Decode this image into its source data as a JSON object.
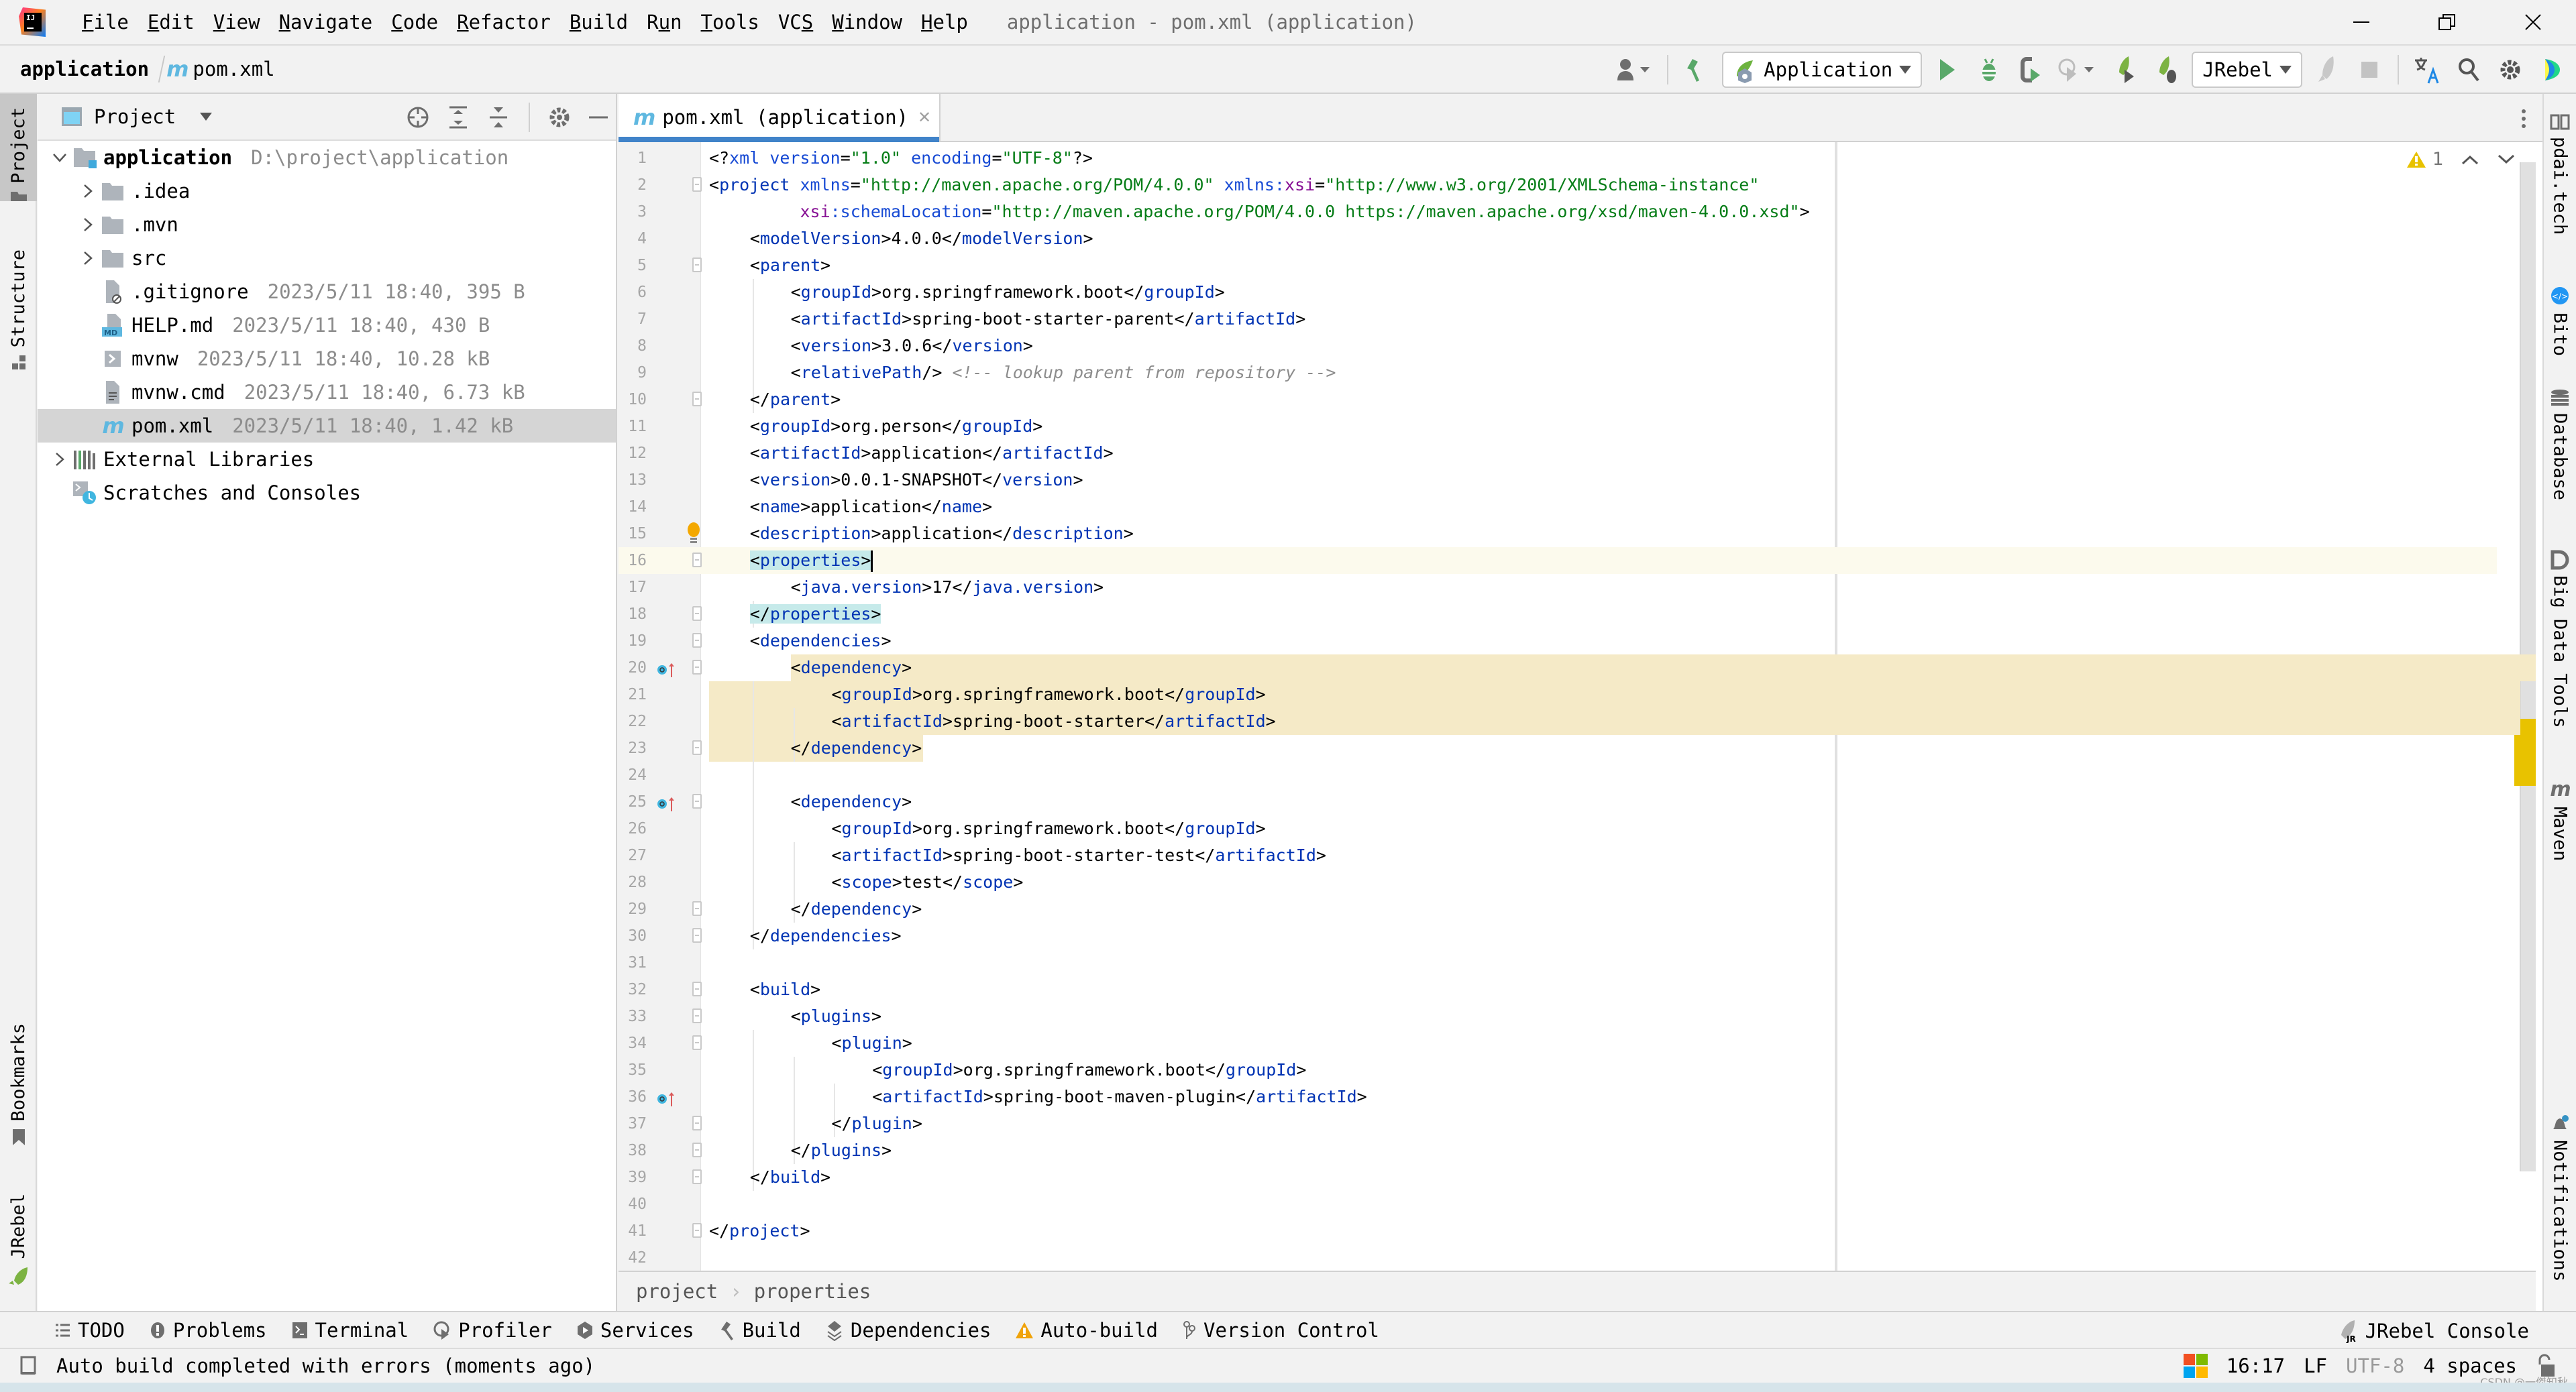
{
  "window": {
    "title": "application - pom.xml (application)",
    "menu": [
      {
        "label": "File",
        "mnemonic": "F",
        "rest": "ile"
      },
      {
        "label": "Edit",
        "mnemonic": "E",
        "rest": "dit"
      },
      {
        "label": "View",
        "mnemonic": "V",
        "rest": "iew"
      },
      {
        "label": "Navigate",
        "mnemonic": "N",
        "rest": "avigate"
      },
      {
        "label": "Code",
        "mnemonic": "C",
        "rest": "ode"
      },
      {
        "label": "Refactor",
        "mnemonic": "R",
        "rest": "efactor"
      },
      {
        "label": "Build",
        "mnemonic": "B",
        "rest": "uild"
      },
      {
        "label": "Run",
        "pre": "R",
        "mnemonic": "u",
        "rest": "n"
      },
      {
        "label": "Tools",
        "mnemonic": "T",
        "rest": "ools"
      },
      {
        "label": "VCS",
        "pre": "VC",
        "mnemonic": "S",
        "rest": ""
      },
      {
        "label": "Window",
        "mnemonic": "W",
        "rest": "indow"
      },
      {
        "label": "Help",
        "mnemonic": "H",
        "rest": "elp"
      }
    ]
  },
  "navbar": {
    "project": "application",
    "file": "pom.xml",
    "file_icon": "m",
    "run_config": "Application",
    "jrebel_config": "JRebel"
  },
  "left_strip": {
    "tabs": [
      "Project",
      "Structure",
      "Bookmarks",
      "JRebel"
    ]
  },
  "project_panel": {
    "title": "Project",
    "tree": [
      {
        "name": "application",
        "meta": "D:\\project\\application",
        "type": "module",
        "expanded": true,
        "depth": 0,
        "bold": true
      },
      {
        "name": ".idea",
        "meta": "",
        "type": "folder",
        "expanded": false,
        "depth": 1
      },
      {
        "name": ".mvn",
        "meta": "",
        "type": "folder",
        "expanded": false,
        "depth": 1
      },
      {
        "name": "src",
        "meta": "",
        "type": "folder",
        "expanded": false,
        "depth": 1
      },
      {
        "name": ".gitignore",
        "meta": "2023/5/11 18:40, 395 B",
        "type": "ignore-file",
        "depth": 1
      },
      {
        "name": "HELP.md",
        "meta": "2023/5/11 18:40, 430 B",
        "type": "markdown-file",
        "depth": 1
      },
      {
        "name": "mvnw",
        "meta": "2023/5/11 18:40, 10.28 kB",
        "type": "shell-file",
        "depth": 1
      },
      {
        "name": "mvnw.cmd",
        "meta": "2023/5/11 18:40, 6.73 kB",
        "type": "text-file",
        "depth": 1
      },
      {
        "name": "pom.xml",
        "meta": "2023/5/11 18:40, 1.42 kB",
        "type": "maven-file",
        "depth": 1,
        "selected": true
      },
      {
        "name": "External Libraries",
        "meta": "",
        "type": "libraries",
        "expanded": false,
        "depth": 0
      },
      {
        "name": "Scratches and Consoles",
        "meta": "",
        "type": "scratches",
        "depth": 0
      }
    ]
  },
  "editor": {
    "tab_label": "pom.xml (application)",
    "warnings_count": "1",
    "caret_line": 16,
    "lines": [
      {
        "n": "1",
        "indent": 0,
        "tokens": [
          [
            "p",
            "<?"
          ],
          [
            "a",
            "xml version"
          ],
          [
            "p",
            "="
          ],
          [
            "s",
            "\"1.0\""
          ],
          [
            "a",
            " encoding"
          ],
          [
            "p",
            "="
          ],
          [
            "s",
            "\"UTF-8\""
          ],
          [
            "p",
            "?>"
          ]
        ]
      },
      {
        "n": "2",
        "indent": 0,
        "fold": true,
        "tokens": [
          [
            "p",
            "<"
          ],
          [
            "t",
            "project "
          ],
          [
            "a",
            "xmlns"
          ],
          [
            "p",
            "="
          ],
          [
            "s",
            "\"http://maven.apache.org/POM/4.0.0\" "
          ],
          [
            "a",
            "xmlns:"
          ],
          [
            "ns",
            "xsi"
          ],
          [
            "p",
            "="
          ],
          [
            "s",
            "\"http://www.w3.org/2001/XMLSchema-instance\""
          ]
        ]
      },
      {
        "n": "3",
        "indent": 0,
        "tokens": [
          [
            "p",
            "         "
          ],
          [
            "ns",
            "xsi"
          ],
          [
            "a",
            ":schemaLocation"
          ],
          [
            "p",
            "="
          ],
          [
            "s",
            "\"http://maven.apache.org/POM/4.0.0 https://maven.apache.org/xsd/maven-4.0.0.xsd\""
          ],
          [
            "p",
            ">"
          ]
        ]
      },
      {
        "n": "4",
        "indent": 1,
        "tokens": [
          [
            "p",
            "<"
          ],
          [
            "t",
            "modelVersion"
          ],
          [
            "p",
            ">4.0.0</"
          ],
          [
            "t",
            "modelVersion"
          ],
          [
            "p",
            ">"
          ]
        ]
      },
      {
        "n": "5",
        "indent": 1,
        "fold": true,
        "tokens": [
          [
            "p",
            "<"
          ],
          [
            "t",
            "parent"
          ],
          [
            "p",
            ">"
          ]
        ]
      },
      {
        "n": "6",
        "indent": 2,
        "tokens": [
          [
            "p",
            "<"
          ],
          [
            "t",
            "groupId"
          ],
          [
            "p",
            ">org.springframework.boot</"
          ],
          [
            "t",
            "groupId"
          ],
          [
            "p",
            ">"
          ]
        ]
      },
      {
        "n": "7",
        "indent": 2,
        "tokens": [
          [
            "p",
            "<"
          ],
          [
            "t",
            "artifactId"
          ],
          [
            "p",
            ">spring-boot-starter-parent</"
          ],
          [
            "t",
            "artifactId"
          ],
          [
            "p",
            ">"
          ]
        ]
      },
      {
        "n": "8",
        "indent": 2,
        "tokens": [
          [
            "p",
            "<"
          ],
          [
            "t",
            "version"
          ],
          [
            "p",
            ">3.0.6</"
          ],
          [
            "t",
            "version"
          ],
          [
            "p",
            ">"
          ]
        ]
      },
      {
        "n": "9",
        "indent": 2,
        "tokens": [
          [
            "p",
            "<"
          ],
          [
            "t",
            "relativePath"
          ],
          [
            "p",
            "/> "
          ],
          [
            "c",
            "<!-- lookup parent from repository -->"
          ]
        ]
      },
      {
        "n": "10",
        "indent": 1,
        "fold": true,
        "tokens": [
          [
            "p",
            "</"
          ],
          [
            "t",
            "parent"
          ],
          [
            "p",
            ">"
          ]
        ]
      },
      {
        "n": "11",
        "indent": 1,
        "tokens": [
          [
            "p",
            "<"
          ],
          [
            "t",
            "groupId"
          ],
          [
            "p",
            ">org.person</"
          ],
          [
            "t",
            "groupId"
          ],
          [
            "p",
            ">"
          ]
        ]
      },
      {
        "n": "12",
        "indent": 1,
        "tokens": [
          [
            "p",
            "<"
          ],
          [
            "t",
            "artifactId"
          ],
          [
            "p",
            ">application</"
          ],
          [
            "t",
            "artifactId"
          ],
          [
            "p",
            ">"
          ]
        ]
      },
      {
        "n": "13",
        "indent": 1,
        "tokens": [
          [
            "p",
            "<"
          ],
          [
            "t",
            "version"
          ],
          [
            "p",
            ">0.0.1-SNAPSHOT</"
          ],
          [
            "t",
            "version"
          ],
          [
            "p",
            ">"
          ]
        ]
      },
      {
        "n": "14",
        "indent": 1,
        "tokens": [
          [
            "p",
            "<"
          ],
          [
            "t",
            "name"
          ],
          [
            "p",
            ">application</"
          ],
          [
            "t",
            "name"
          ],
          [
            "p",
            ">"
          ]
        ]
      },
      {
        "n": "15",
        "indent": 1,
        "bulb": true,
        "tokens": [
          [
            "p",
            "<"
          ],
          [
            "t",
            "description"
          ],
          [
            "p",
            ">application</"
          ],
          [
            "t",
            "description"
          ],
          [
            "p",
            ">"
          ]
        ]
      },
      {
        "n": "16",
        "indent": 1,
        "fold": true,
        "tag_highlight": true,
        "tokens": [
          [
            "p",
            "<"
          ],
          [
            "t",
            "properties"
          ],
          [
            "p",
            ">"
          ]
        ]
      },
      {
        "n": "17",
        "indent": 2,
        "tokens": [
          [
            "p",
            "<"
          ],
          [
            "t",
            "java.version"
          ],
          [
            "p",
            ">17</"
          ],
          [
            "t",
            "java.version"
          ],
          [
            "p",
            ">"
          ]
        ]
      },
      {
        "n": "18",
        "indent": 1,
        "fold": true,
        "tag_highlight": true,
        "tokens": [
          [
            "p",
            "</"
          ],
          [
            "t",
            "properties"
          ],
          [
            "p",
            ">"
          ]
        ]
      },
      {
        "n": "19",
        "indent": 1,
        "fold": true,
        "tokens": [
          [
            "p",
            "<"
          ],
          [
            "t",
            "dependencies"
          ],
          [
            "p",
            ">"
          ]
        ]
      },
      {
        "n": "20",
        "indent": 2,
        "fold": true,
        "mark": true,
        "tokens": [
          [
            "p",
            "<"
          ],
          [
            "t",
            "dependency"
          ],
          [
            "p",
            ">"
          ]
        ]
      },
      {
        "n": "21",
        "indent": 3,
        "tokens": [
          [
            "p",
            "<"
          ],
          [
            "t",
            "groupId"
          ],
          [
            "p",
            ">org.springframework.boot</"
          ],
          [
            "t",
            "groupId"
          ],
          [
            "p",
            ">"
          ]
        ]
      },
      {
        "n": "22",
        "indent": 3,
        "tokens": [
          [
            "p",
            "<"
          ],
          [
            "t",
            "artifactId"
          ],
          [
            "p",
            ">spring-boot-starter</"
          ],
          [
            "t",
            "artifactId"
          ],
          [
            "p",
            ">"
          ]
        ]
      },
      {
        "n": "23",
        "indent": 2,
        "fold": true,
        "tokens": [
          [
            "p",
            "</"
          ],
          [
            "t",
            "dependency"
          ],
          [
            "p",
            ">"
          ]
        ]
      },
      {
        "n": "24",
        "indent": 0,
        "tokens": []
      },
      {
        "n": "25",
        "indent": 2,
        "fold": true,
        "mark": true,
        "tokens": [
          [
            "p",
            "<"
          ],
          [
            "t",
            "dependency"
          ],
          [
            "p",
            ">"
          ]
        ]
      },
      {
        "n": "26",
        "indent": 3,
        "tokens": [
          [
            "p",
            "<"
          ],
          [
            "t",
            "groupId"
          ],
          [
            "p",
            ">org.springframework.boot</"
          ],
          [
            "t",
            "groupId"
          ],
          [
            "p",
            ">"
          ]
        ]
      },
      {
        "n": "27",
        "indent": 3,
        "tokens": [
          [
            "p",
            "<"
          ],
          [
            "t",
            "artifactId"
          ],
          [
            "p",
            ">spring-boot-starter-test</"
          ],
          [
            "t",
            "artifactId"
          ],
          [
            "p",
            ">"
          ]
        ]
      },
      {
        "n": "28",
        "indent": 3,
        "tokens": [
          [
            "p",
            "<"
          ],
          [
            "t",
            "scope"
          ],
          [
            "p",
            ">test</"
          ],
          [
            "t",
            "scope"
          ],
          [
            "p",
            ">"
          ]
        ]
      },
      {
        "n": "29",
        "indent": 2,
        "fold": true,
        "tokens": [
          [
            "p",
            "</"
          ],
          [
            "t",
            "dependency"
          ],
          [
            "p",
            ">"
          ]
        ]
      },
      {
        "n": "30",
        "indent": 1,
        "fold": true,
        "tokens": [
          [
            "p",
            "</"
          ],
          [
            "t",
            "dependencies"
          ],
          [
            "p",
            ">"
          ]
        ]
      },
      {
        "n": "31",
        "indent": 0,
        "tokens": []
      },
      {
        "n": "32",
        "indent": 1,
        "fold": true,
        "tokens": [
          [
            "p",
            "<"
          ],
          [
            "t",
            "build"
          ],
          [
            "p",
            ">"
          ]
        ]
      },
      {
        "n": "33",
        "indent": 2,
        "fold": true,
        "tokens": [
          [
            "p",
            "<"
          ],
          [
            "t",
            "plugins"
          ],
          [
            "p",
            ">"
          ]
        ]
      },
      {
        "n": "34",
        "indent": 3,
        "fold": true,
        "tokens": [
          [
            "p",
            "<"
          ],
          [
            "t",
            "plugin"
          ],
          [
            "p",
            ">"
          ]
        ]
      },
      {
        "n": "35",
        "indent": 4,
        "tokens": [
          [
            "p",
            "<"
          ],
          [
            "t",
            "groupId"
          ],
          [
            "p",
            ">org.springframework.boot</"
          ],
          [
            "t",
            "groupId"
          ],
          [
            "p",
            ">"
          ]
        ]
      },
      {
        "n": "36",
        "indent": 4,
        "mark": true,
        "tokens": [
          [
            "p",
            "<"
          ],
          [
            "t",
            "artifactId"
          ],
          [
            "p",
            ">spring-boot-maven-plugin</"
          ],
          [
            "t",
            "artifactId"
          ],
          [
            "p",
            ">"
          ]
        ]
      },
      {
        "n": "37",
        "indent": 3,
        "fold": true,
        "tokens": [
          [
            "p",
            "</"
          ],
          [
            "t",
            "plugin"
          ],
          [
            "p",
            ">"
          ]
        ]
      },
      {
        "n": "38",
        "indent": 2,
        "fold": true,
        "tokens": [
          [
            "p",
            "</"
          ],
          [
            "t",
            "plugins"
          ],
          [
            "p",
            ">"
          ]
        ]
      },
      {
        "n": "39",
        "indent": 1,
        "fold": true,
        "tokens": [
          [
            "p",
            "</"
          ],
          [
            "t",
            "build"
          ],
          [
            "p",
            ">"
          ]
        ]
      },
      {
        "n": "40",
        "indent": 0,
        "tokens": []
      },
      {
        "n": "41",
        "indent": 0,
        "fold": true,
        "tokens": [
          [
            "p",
            "</"
          ],
          [
            "t",
            "project"
          ],
          [
            "p",
            ">"
          ]
        ]
      },
      {
        "n": "42",
        "indent": 0,
        "tokens": []
      }
    ],
    "breadcrumbs": [
      "project",
      "properties"
    ]
  },
  "right_strip": {
    "tabs": [
      "pdai.tech",
      "Bito",
      "Database",
      "Big Data Tools",
      "Maven",
      "Notifications"
    ]
  },
  "tool_windows": [
    {
      "label": "TODO",
      "icon": "list-icon"
    },
    {
      "label": "Problems",
      "icon": "problems-icon"
    },
    {
      "label": "Terminal",
      "icon": "terminal-icon"
    },
    {
      "label": "Profiler",
      "icon": "profiler-icon"
    },
    {
      "label": "Services",
      "icon": "services-icon"
    },
    {
      "label": "Build",
      "icon": "hammer-icon"
    },
    {
      "label": "Dependencies",
      "icon": "dependencies-icon"
    },
    {
      "label": "Auto-build",
      "icon": "warning-icon"
    },
    {
      "label": "Version Control",
      "icon": "vcs-icon"
    }
  ],
  "tool_windows_right": {
    "label": "JRebel Console"
  },
  "status": {
    "message": "Auto build completed with errors (moments ago)",
    "position": "16:17",
    "line_separator": "LF",
    "encoding": "UTF-8",
    "indent": "4 spaces",
    "watermark": "CSDN @一傑知秋"
  },
  "colors": {
    "accent_tab": "#4083c9",
    "tag": "#0033b3",
    "string": "#067d17",
    "namespace": "#871094",
    "dependency_highlight": "#f5eac7",
    "tag_match": "#c6eaea",
    "warning": "#e8c200"
  }
}
